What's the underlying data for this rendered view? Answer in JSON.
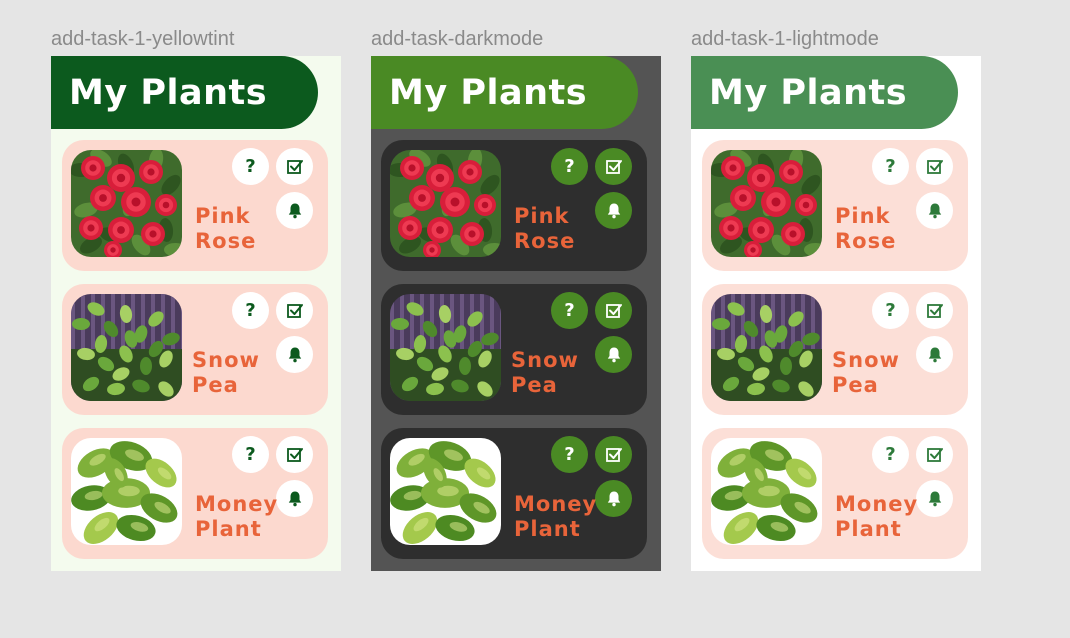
{
  "frames": [
    {
      "label": "add-task-1-yellowtint",
      "title": "My Plants",
      "colors": {
        "background": "#f4fbee",
        "header": "#0c5a1e",
        "card": "#fcd9cf",
        "button": "#ffffff",
        "icon": "#0c5a1e",
        "plant_text": "#e8643a"
      },
      "plants": [
        {
          "name_line1": "Pink",
          "name_line2": "Rose",
          "photo": "rose-photo"
        },
        {
          "name_line1": "Snow",
          "name_line2": "Pea",
          "photo": "snow-pea-photo"
        },
        {
          "name_line1": "Money",
          "name_line2": "Plant",
          "photo": "money-plant-photo"
        }
      ],
      "buttons": {
        "help": "?",
        "help_icon": "question-icon",
        "task_icon": "checkbox-icon",
        "reminder_icon": "bell-icon"
      }
    },
    {
      "label": "add-task-darkmode",
      "title": "My Plants",
      "colors": {
        "background": "#545454",
        "header": "#4a8a24",
        "card": "#2e2e2e",
        "button": "#4a8a24",
        "icon": "#ffffff",
        "plant_text": "#e8643a"
      },
      "plants": [
        {
          "name_line1": "Pink",
          "name_line2": "Rose",
          "photo": "rose-photo"
        },
        {
          "name_line1": "Snow",
          "name_line2": "Pea",
          "photo": "snow-pea-photo"
        },
        {
          "name_line1": "Money",
          "name_line2": "Plant",
          "photo": "money-plant-photo"
        }
      ],
      "buttons": {
        "help": "?",
        "help_icon": "question-icon",
        "task_icon": "checkbox-icon",
        "reminder_icon": "bell-icon"
      }
    },
    {
      "label": "add-task-1-lightmode",
      "title": "My Plants",
      "colors": {
        "background": "#ffffff",
        "header": "#4a8f54",
        "card": "#fcdfd7",
        "button": "#ffffff",
        "icon": "#2d7a3a",
        "plant_text": "#e8643a"
      },
      "plants": [
        {
          "name_line1": "Pink",
          "name_line2": "Rose",
          "photo": "rose-photo"
        },
        {
          "name_line1": "Snow",
          "name_line2": "Pea",
          "photo": "snow-pea-photo"
        },
        {
          "name_line1": "Money",
          "name_line2": "Plant",
          "photo": "money-plant-photo"
        }
      ],
      "buttons": {
        "help": "?",
        "help_icon": "question-icon",
        "task_icon": "checkbox-icon",
        "reminder_icon": "bell-icon"
      }
    }
  ]
}
